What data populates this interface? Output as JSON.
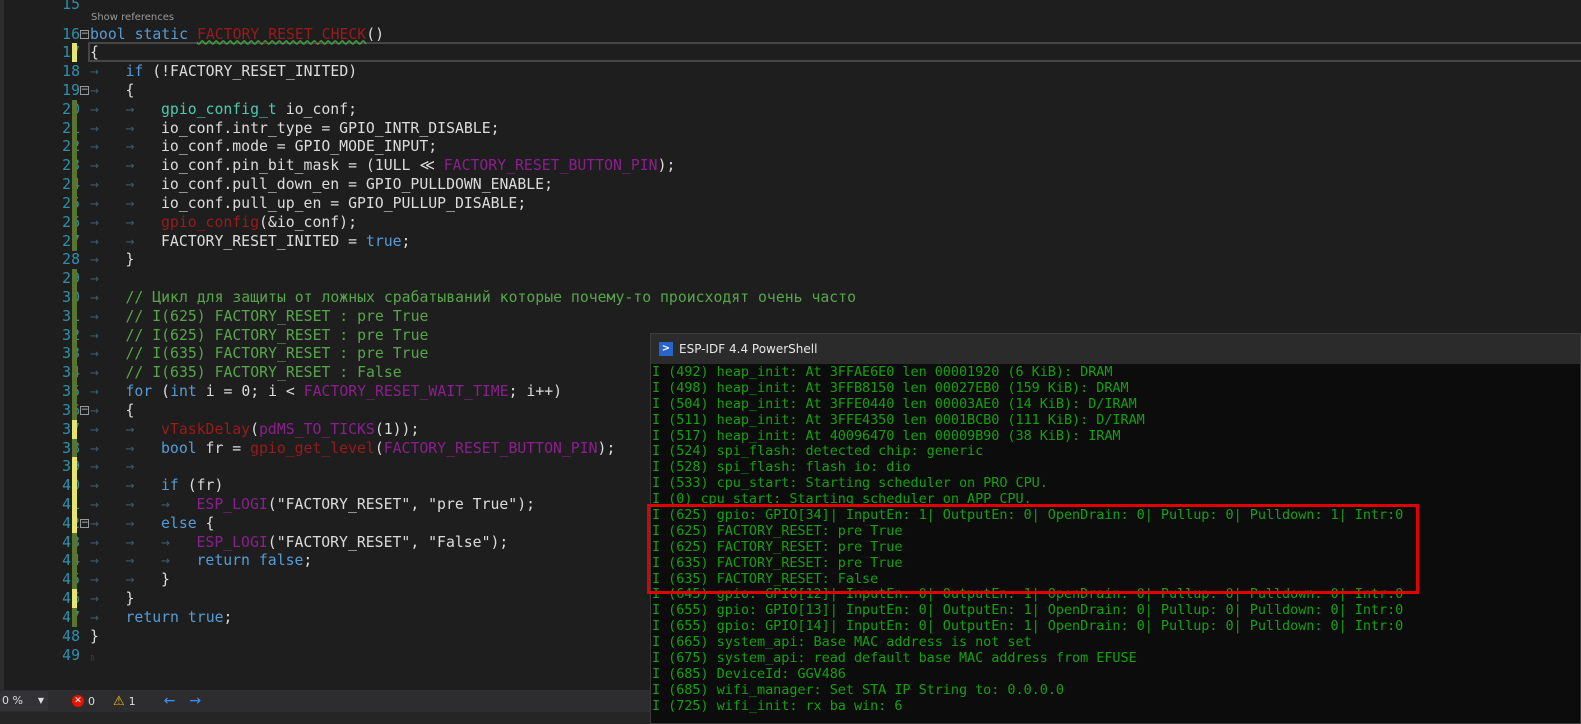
{
  "editor": {
    "show_references": "Show references",
    "first_partial_line": 15,
    "lines": [
      {
        "n": 16,
        "indent": 0,
        "fold": true,
        "tokens": [
          {
            "t": "bool",
            "c": "kw"
          },
          {
            "t": " "
          },
          {
            "t": "static",
            "c": "kw"
          },
          {
            "t": " "
          },
          {
            "t": "FACTORY_RESET_CHECK",
            "c": "fn err"
          },
          {
            "t": "()"
          }
        ]
      },
      {
        "n": 17,
        "indent": 0,
        "change": "unsaved",
        "tokens": [
          {
            "t": "{"
          }
        ]
      },
      {
        "n": 18,
        "indent": 1,
        "tokens": [
          {
            "t": "if",
            "c": "kw"
          },
          {
            "t": " (!FACTORY_RESET_INITED)"
          }
        ]
      },
      {
        "n": 19,
        "indent": 1,
        "fold": true,
        "tokens": [
          {
            "t": "{"
          }
        ]
      },
      {
        "n": 20,
        "indent": 2,
        "change": "saved",
        "tokens": [
          {
            "t": "gpio_config_t",
            "c": "ty"
          },
          {
            "t": " io_conf;"
          }
        ]
      },
      {
        "n": 21,
        "indent": 2,
        "change": "saved",
        "tokens": [
          {
            "t": "io_conf.intr_type = GPIO_INTR_DISABLE;"
          }
        ]
      },
      {
        "n": 22,
        "indent": 2,
        "change": "saved",
        "tokens": [
          {
            "t": "io_conf.mode = GPIO_MODE_INPUT;"
          }
        ]
      },
      {
        "n": 23,
        "indent": 2,
        "change": "saved",
        "tokens": [
          {
            "t": "io_conf.pin_bit_mask = (1ULL ≪ "
          },
          {
            "t": "FACTORY_RESET_BUTTON_PIN",
            "c": "mac"
          },
          {
            "t": ");"
          }
        ]
      },
      {
        "n": 24,
        "indent": 2,
        "change": "saved",
        "tokens": [
          {
            "t": "io_conf.pull_down_en = GPIO_PULLDOWN_ENABLE;"
          }
        ]
      },
      {
        "n": 25,
        "indent": 2,
        "change": "saved",
        "tokens": [
          {
            "t": "io_conf.pull_up_en = GPIO_PULLUP_DISABLE;"
          }
        ]
      },
      {
        "n": 26,
        "indent": 2,
        "change": "saved",
        "tokens": [
          {
            "t": "gpio_config",
            "c": "fn"
          },
          {
            "t": "(&io_conf);"
          }
        ]
      },
      {
        "n": 27,
        "indent": 2,
        "change": "saved",
        "tokens": [
          {
            "t": "FACTORY_RESET_INITED = "
          },
          {
            "t": "true",
            "c": "kw"
          },
          {
            "t": ";"
          }
        ]
      },
      {
        "n": 28,
        "indent": 1,
        "tokens": [
          {
            "t": "}"
          }
        ]
      },
      {
        "n": 29,
        "indent": 1,
        "change": "saved",
        "tokens": []
      },
      {
        "n": 30,
        "indent": 1,
        "change": "saved",
        "tokens": [
          {
            "t": "// Цикл для защиты от ложных срабатываний которые почему-то происходят очень часто",
            "c": "cm"
          }
        ]
      },
      {
        "n": 31,
        "indent": 1,
        "change": "saved",
        "tokens": [
          {
            "t": "// I(625) FACTORY_RESET : pre True",
            "c": "cm"
          }
        ]
      },
      {
        "n": 32,
        "indent": 1,
        "change": "saved",
        "tokens": [
          {
            "t": "// I(625) FACTORY_RESET : pre True",
            "c": "cm"
          }
        ]
      },
      {
        "n": 33,
        "indent": 1,
        "change": "saved",
        "tokens": [
          {
            "t": "// I(635) FACTORY_RESET : pre True",
            "c": "cm"
          }
        ]
      },
      {
        "n": 34,
        "indent": 1,
        "change": "saved",
        "tokens": [
          {
            "t": "// I(635) FACTORY_RESET : False",
            "c": "cm"
          }
        ]
      },
      {
        "n": 35,
        "indent": 1,
        "change": "saved",
        "tokens": [
          {
            "t": "for",
            "c": "kw"
          },
          {
            "t": " ("
          },
          {
            "t": "int",
            "c": "kw"
          },
          {
            "t": " i = 0; i < "
          },
          {
            "t": "FACTORY_RESET_WAIT_TIME",
            "c": "mac"
          },
          {
            "t": "; i++)"
          }
        ]
      },
      {
        "n": 36,
        "indent": 1,
        "change": "saved",
        "fold": true,
        "tokens": [
          {
            "t": "{"
          }
        ]
      },
      {
        "n": 37,
        "indent": 2,
        "change": "unsaved",
        "tokens": [
          {
            "t": "vTaskDelay",
            "c": "fn"
          },
          {
            "t": "("
          },
          {
            "t": "pdMS_TO_TICKS",
            "c": "mac"
          },
          {
            "t": "(1));"
          }
        ]
      },
      {
        "n": 38,
        "indent": 2,
        "change": "saved",
        "tokens": [
          {
            "t": "bool",
            "c": "kw"
          },
          {
            "t": " fr = "
          },
          {
            "t": "gpio_get_level",
            "c": "fn"
          },
          {
            "t": "("
          },
          {
            "t": "FACTORY_RESET_BUTTON_PIN",
            "c": "mac"
          },
          {
            "t": ");"
          }
        ]
      },
      {
        "n": 39,
        "indent": 2,
        "change": "unsaved",
        "tokens": []
      },
      {
        "n": 40,
        "indent": 2,
        "change": "unsaved",
        "tokens": [
          {
            "t": "if",
            "c": "kw"
          },
          {
            "t": " (fr)"
          }
        ]
      },
      {
        "n": 41,
        "indent": 3,
        "change": "unsaved",
        "tokens": [
          {
            "t": "ESP_LOGI",
            "c": "mac"
          },
          {
            "t": "(\"FACTORY_RESET\", \"pre True\");"
          }
        ]
      },
      {
        "n": 42,
        "indent": 2,
        "change": "unsaved",
        "fold": true,
        "tokens": [
          {
            "t": "else",
            "c": "kw"
          },
          {
            "t": " {"
          }
        ]
      },
      {
        "n": 43,
        "indent": 3,
        "change": "saved",
        "tokens": [
          {
            "t": "ESP_LOGI",
            "c": "mac"
          },
          {
            "t": "(\"FACTORY_RESET\", \"False\");"
          }
        ]
      },
      {
        "n": 44,
        "indent": 3,
        "change": "saved",
        "tokens": [
          {
            "t": "return",
            "c": "kw"
          },
          {
            "t": " "
          },
          {
            "t": "false",
            "c": "kw"
          },
          {
            "t": ";"
          }
        ]
      },
      {
        "n": 45,
        "indent": 2,
        "change": "saved",
        "tokens": [
          {
            "t": "}"
          }
        ]
      },
      {
        "n": 46,
        "indent": 1,
        "change": "unsaved",
        "tokens": [
          {
            "t": "}"
          }
        ]
      },
      {
        "n": 47,
        "indent": 1,
        "change": "saved",
        "tokens": [
          {
            "t": "return",
            "c": "kw"
          },
          {
            "t": " "
          },
          {
            "t": "true",
            "c": "kw"
          },
          {
            "t": ";"
          }
        ]
      },
      {
        "n": 48,
        "indent": 0,
        "tokens": [
          {
            "t": "}"
          }
        ]
      },
      {
        "n": 49,
        "indent": 0,
        "tokens": []
      }
    ]
  },
  "status": {
    "zoom": "0 %",
    "errors": "0",
    "warnings": "1",
    "error_icon": "error-circle-icon",
    "warning_icon": "warning-triangle-icon"
  },
  "terminal": {
    "title": "ESP-IDF 4.4 PowerShell",
    "icon": "powershell-icon",
    "text_color": "#13a10e",
    "highlight_color": "#e00000",
    "lines": [
      "I (492) heap_init: At 3FFAE6E0 len 00001920 (6 KiB): DRAM",
      "I (498) heap_init: At 3FFB8150 len 00027EB0 (159 KiB): DRAM",
      "I (504) heap_init: At 3FFE0440 len 00003AE0 (14 KiB): D/IRAM",
      "I (511) heap_init: At 3FFE4350 len 0001BCB0 (111 KiB): D/IRAM",
      "I (517) heap_init: At 40096470 len 00009B90 (38 KiB): IRAM",
      "I (524) spi_flash: detected chip: generic",
      "I (528) spi_flash: flash io: dio",
      "I (533) cpu_start: Starting scheduler on PRO CPU.",
      "I (0) cpu_start: Starting scheduler on APP CPU.",
      "I (625) gpio: GPIO[34]| InputEn: 1| OutputEn: 0| OpenDrain: 0| Pullup: 0| Pulldown: 1| Intr:0",
      "I (625) FACTORY_RESET: pre True",
      "I (625) FACTORY_RESET: pre True",
      "I (635) FACTORY_RESET: pre True",
      "I (635) FACTORY_RESET: False",
      "I (645) gpio: GPIO[12]| InputEn: 0| OutputEn: 1| OpenDrain: 0| Pullup: 0| Pulldown: 0| Intr:0",
      "I (655) gpio: GPIO[13]| InputEn: 0| OutputEn: 1| OpenDrain: 0| Pullup: 0| Pulldown: 0| Intr:0",
      "I (655) gpio: GPIO[14]| InputEn: 0| OutputEn: 1| OpenDrain: 0| Pullup: 0| Pulldown: 0| Intr:0",
      "I (665) system_api: Base MAC address is not set",
      "I (675) system_api: read default base MAC address from EFUSE",
      "I (685) DeviceId: GGV486",
      "I (685) wifi_manager: Set STA IP String to: 0.0.0.0",
      "I (725) wifi_init: rx ba win: 6"
    ]
  }
}
